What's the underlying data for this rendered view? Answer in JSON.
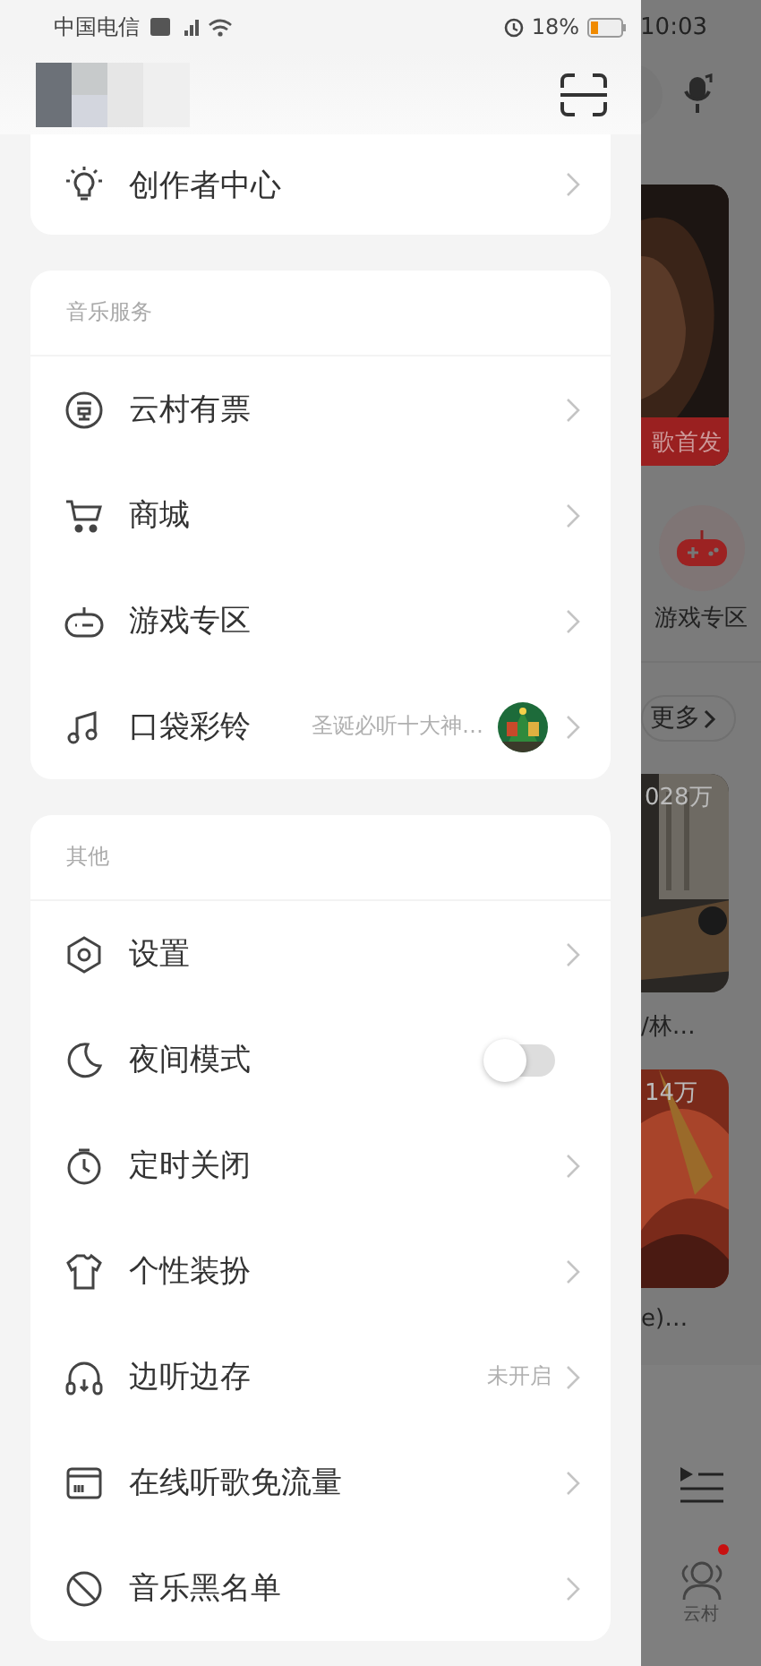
{
  "status_bar": {
    "carrier": "中国电信",
    "battery": "18%",
    "time": "10:03"
  },
  "sections": [
    {
      "items": [
        {
          "label": "创作者中心",
          "kind": "link"
        }
      ]
    },
    {
      "title": "音乐服务",
      "items": [
        {
          "label": "云村有票",
          "kind": "link"
        },
        {
          "label": "商城",
          "kind": "link"
        },
        {
          "label": "游戏专区",
          "kind": "link"
        },
        {
          "label": "口袋彩铃",
          "kind": "link",
          "hint": "圣诞必听十大神…",
          "cover": true
        }
      ]
    },
    {
      "title": "其他",
      "items": [
        {
          "label": "设置",
          "kind": "link"
        },
        {
          "label": "夜间模式",
          "kind": "toggle",
          "on": false
        },
        {
          "label": "定时关闭",
          "kind": "link"
        },
        {
          "label": "个性装扮",
          "kind": "link"
        },
        {
          "label": "边听边存",
          "kind": "link",
          "hint": "未开启"
        },
        {
          "label": "在线听歌免流量",
          "kind": "link"
        },
        {
          "label": "音乐黑名单",
          "kind": "link"
        }
      ]
    }
  ],
  "background": {
    "banner": "歌首发",
    "shortcut": "游戏专区",
    "more": "更多",
    "cards": [
      {
        "count": "028万",
        "caption": "/林…"
      },
      {
        "count": "14万",
        "caption": "e)…"
      }
    ],
    "tab": "云村"
  }
}
